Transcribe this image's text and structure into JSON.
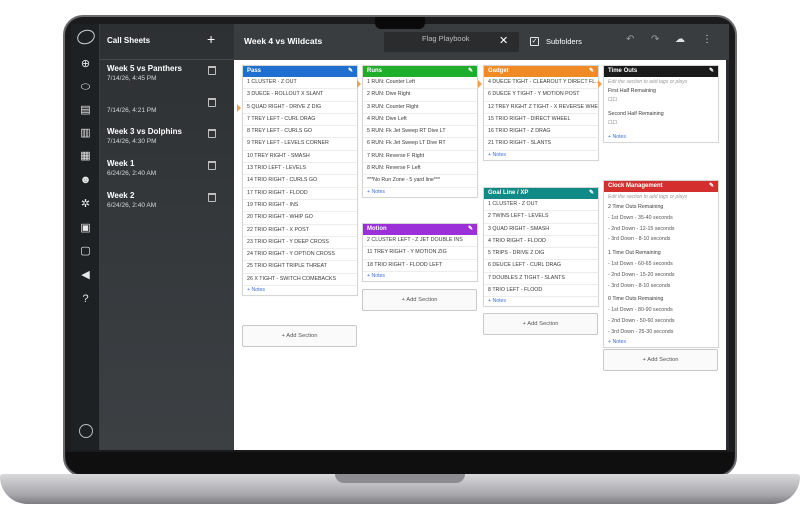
{
  "rail_icons": [
    "plus-circle-icon",
    "football-icon",
    "clipboard-icon",
    "book-icon",
    "calendar-icon",
    "people-icon",
    "gear-icon",
    "film-icon",
    "board-icon",
    "megaphone-icon",
    "help-icon"
  ],
  "sidebar": {
    "title": "Call Sheets",
    "add_label": "+",
    "items": [
      {
        "name": "Week 5 vs Panthers",
        "date": "7/14/26, 4:45 PM"
      },
      {
        "name": "",
        "date": "7/14/26, 4:21 PM"
      },
      {
        "name": "Week 3 vs Dolphins",
        "date": "7/14/26, 4:30 PM"
      },
      {
        "name": "Week 1",
        "date": "6/24/26, 2:40 AM"
      },
      {
        "name": "Week 2",
        "date": "6/24/26, 2:40 AM"
      }
    ]
  },
  "topbar": {
    "title": "Week 4 vs Wildcats",
    "tab_label": "Flag Playbook",
    "close_label": "✕",
    "subfolders_label": "Subfolders",
    "subfolders_checked": "✓"
  },
  "colors": {
    "pass": "#1f6fd1",
    "runs": "#1fae2b",
    "gadget": "#f08a24",
    "motion": "#9b2fd8",
    "goal_line": "#0f8a86",
    "time_outs": "#1a1a1a",
    "clock": "#d32f2f"
  },
  "columns": {
    "pass": {
      "title": "Pass",
      "plays": [
        "1  CLUSTER - Z OUT",
        "3  DUECE - ROLLOUT X SLANT",
        "5  QUAD RIGHT - DRIVE Z DIG",
        "7  TREY LEFT - CURL DRAG",
        "8  TREY LEFT - CURLS GO",
        "9  TREY LEFT - LEVELS CORNER",
        "10  TREY RIGHT - SMASH",
        "13  TRIO LEFT - LEVELS",
        "14  TRIO RIGHT - CURLS GO",
        "17  TRIO RIGHT - FLOOD",
        "19  TRIO RIGHT - INS",
        "20  TRIO RIGHT - WHIP GO",
        "22  TRIO RIGHT - X POST",
        "23  TRIO RIGHT - Y DEEP CROSS",
        "24  TRIO RIGHT - Y OPTION CROSS",
        "25  TRIO RIGHT TRIPLE THREAT",
        "26  X TIGHT - SWITCH COMEBACKS"
      ],
      "notes": "+ Notes"
    },
    "runs": {
      "title": "Runs",
      "plays": [
        "1  RUN: Counter Left",
        "2  RUN: Dive Right",
        "3  RUN: Counter Right",
        "4  RUN: Dive Left",
        "5  RUN: Fk Jet Sweep RT Dive LT",
        "6  RUN: Fk Jet Sweep LT Dive RT",
        "7  RUN: Reverse F Right",
        "8  RUN: Reverse F Left",
        "***No Run Zone - 5 yard line***"
      ],
      "notes": "+ Notes"
    },
    "motion": {
      "title": "Motion",
      "plays": [
        "2  CLUSTER LEFT - Z JET DOUBLE INS",
        "11  TREY RIGHT - Y MOTION ZIG",
        "18  TRIO RIGHT - FLOOD LEFT"
      ],
      "notes": "+ Notes"
    },
    "gadget": {
      "title": "Gadget",
      "plays": [
        "4  DUECE TIGHT - CLEAROUT Y DIRECT FL...",
        "6  DUECE Y TIGHT - Y MOTION POST",
        "12  TREY RIGHT Z TIGHT - X REVERSE WHE...",
        "15  TRIO RIGHT - DIRECT WHEEL",
        "16  TRIO RIGHT - Z DRAG",
        "21  TRIO RIGHT - SLANTS"
      ],
      "notes": "+ Notes"
    },
    "goal_line": {
      "title": "Goal Line / XP",
      "plays": [
        "1  CLUSTER - Z OUT",
        "2  TWINS LEFT - LEVELS",
        "3  QUAD RIGHT - SMASH",
        "4  TRIO RIGHT - FLOOD",
        "5  TRIPS - DRIVE Z DIG",
        "6  DEUCE LEFT - CURL DRAG",
        "7  DOUBLES Z TIGHT - SLANTS",
        "8  TRIO LEFT - FLOOD"
      ],
      "notes": "+ Notes"
    },
    "time_outs": {
      "title": "Time Outs",
      "hint": "Edit the section to add tags or plays",
      "first_label": "First Half Remaining",
      "first_boxes": "☐☐",
      "second_label": "Second Half Remaining",
      "second_boxes": "☐☐",
      "notes": "+ Notes"
    },
    "clock": {
      "title": "Clock Management",
      "hint": "Edit the section to add tags or plays",
      "lines": [
        "2 Time Outs Remaining",
        "- 1st Down - 35-40 seconds",
        "- 2nd Down - 12-15 seconds",
        "- 3rd Down - 8-10 seconds",
        "1 Time Out Remaining",
        "- 1st Down - 60-65 seconds",
        "- 2nd Down - 15-20 seconds",
        "- 3rd Down - 8-10 seconds",
        "0 Time Outs Remaining",
        "- 1st Down - 80-90 seconds",
        "- 2nd Down - 50-60 seconds",
        "- 3rd Down - 25-30 seconds"
      ],
      "notes": "+ Notes"
    }
  },
  "add_section_label": "+  Add Section"
}
